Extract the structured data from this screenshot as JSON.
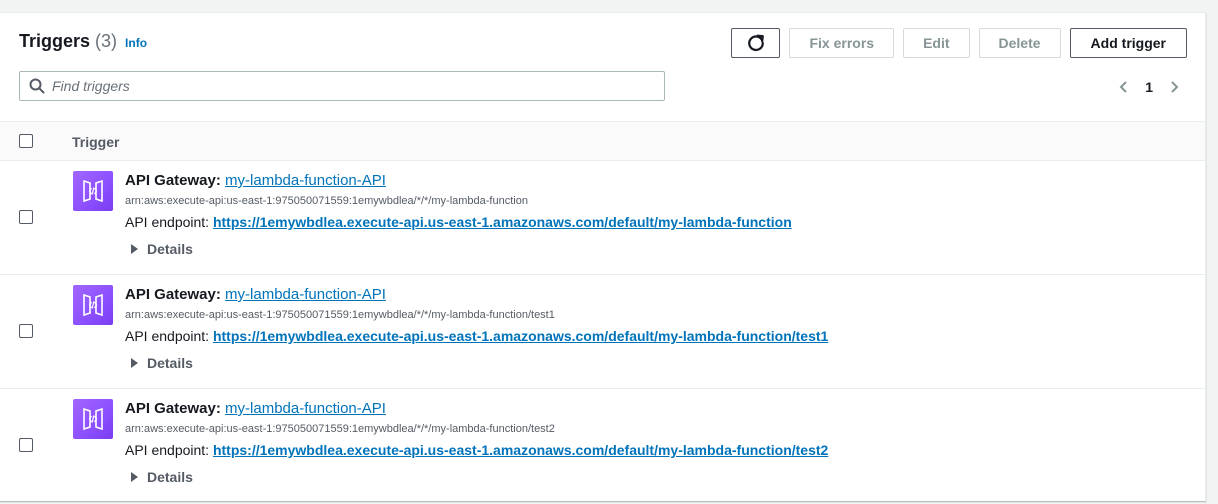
{
  "header": {
    "title": "Triggers",
    "count": "(3)",
    "info": "Info"
  },
  "actions": {
    "refresh_icon": "refresh-icon",
    "fix_errors": "Fix errors",
    "edit": "Edit",
    "delete": "Delete",
    "add_trigger": "Add trigger"
  },
  "search": {
    "placeholder": "Find triggers",
    "value": ""
  },
  "pagination": {
    "page": "1"
  },
  "table": {
    "column": "Trigger",
    "rows": [
      {
        "service": "API Gateway",
        "colon": ":",
        "api_name": "my-lambda-function-API",
        "arn": "arn:aws:execute-api:us-east-1:975050071559:1emywbdlea/*/*/my-lambda-function",
        "endpoint_label": "API endpoint:",
        "endpoint_url": "https://1emywbdlea.execute-api.us-east-1.amazonaws.com/default/my-lambda-function",
        "details": "Details"
      },
      {
        "service": "API Gateway",
        "colon": ":",
        "api_name": "my-lambda-function-API",
        "arn": "arn:aws:execute-api:us-east-1:975050071559:1emywbdlea/*/*/my-lambda-function/test1",
        "endpoint_label": "API endpoint:",
        "endpoint_url": "https://1emywbdlea.execute-api.us-east-1.amazonaws.com/default/my-lambda-function/test1",
        "details": "Details"
      },
      {
        "service": "API Gateway",
        "colon": ":",
        "api_name": "my-lambda-function-API",
        "arn": "arn:aws:execute-api:us-east-1:975050071559:1emywbdlea/*/*/my-lambda-function/test2",
        "endpoint_label": "API endpoint:",
        "endpoint_url": "https://1emywbdlea.execute-api.us-east-1.amazonaws.com/default/my-lambda-function/test2",
        "details": "Details"
      }
    ]
  },
  "colors": {
    "link": "#0073bb",
    "api_gateway_icon": "#8c4fff"
  }
}
